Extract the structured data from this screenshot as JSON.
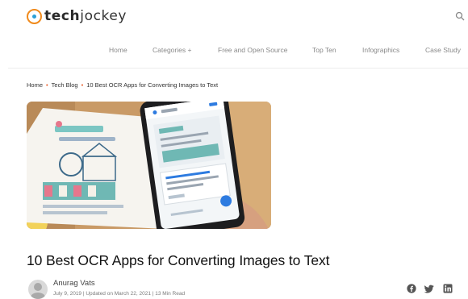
{
  "brand": {
    "name_bold": "tech",
    "name_light": "jockey"
  },
  "nav": {
    "items": [
      {
        "label": "Home"
      },
      {
        "label": "Categories +"
      },
      {
        "label": "Free and Open Source"
      },
      {
        "label": "Top Ten"
      },
      {
        "label": "Infographics"
      },
      {
        "label": "Case Study"
      }
    ]
  },
  "breadcrumb": {
    "items": [
      "Home",
      "Tech Blog",
      "10 Best OCR Apps for Converting Images to Text"
    ],
    "separator": "•"
  },
  "article": {
    "title": "10 Best OCR Apps for Converting Images to Text",
    "author": "Anurag Vats",
    "meta": "July 9, 2019 | Updated on March 22, 2021 | 13 Min Read"
  },
  "share": {
    "icons": [
      "facebook-icon",
      "twitter-icon",
      "linkedin-icon"
    ]
  },
  "colors": {
    "accent": "#e8541e",
    "logo_ring": "#f08a1c",
    "logo_dot": "#2b9fd6",
    "nav_text": "#8a8a8a"
  }
}
